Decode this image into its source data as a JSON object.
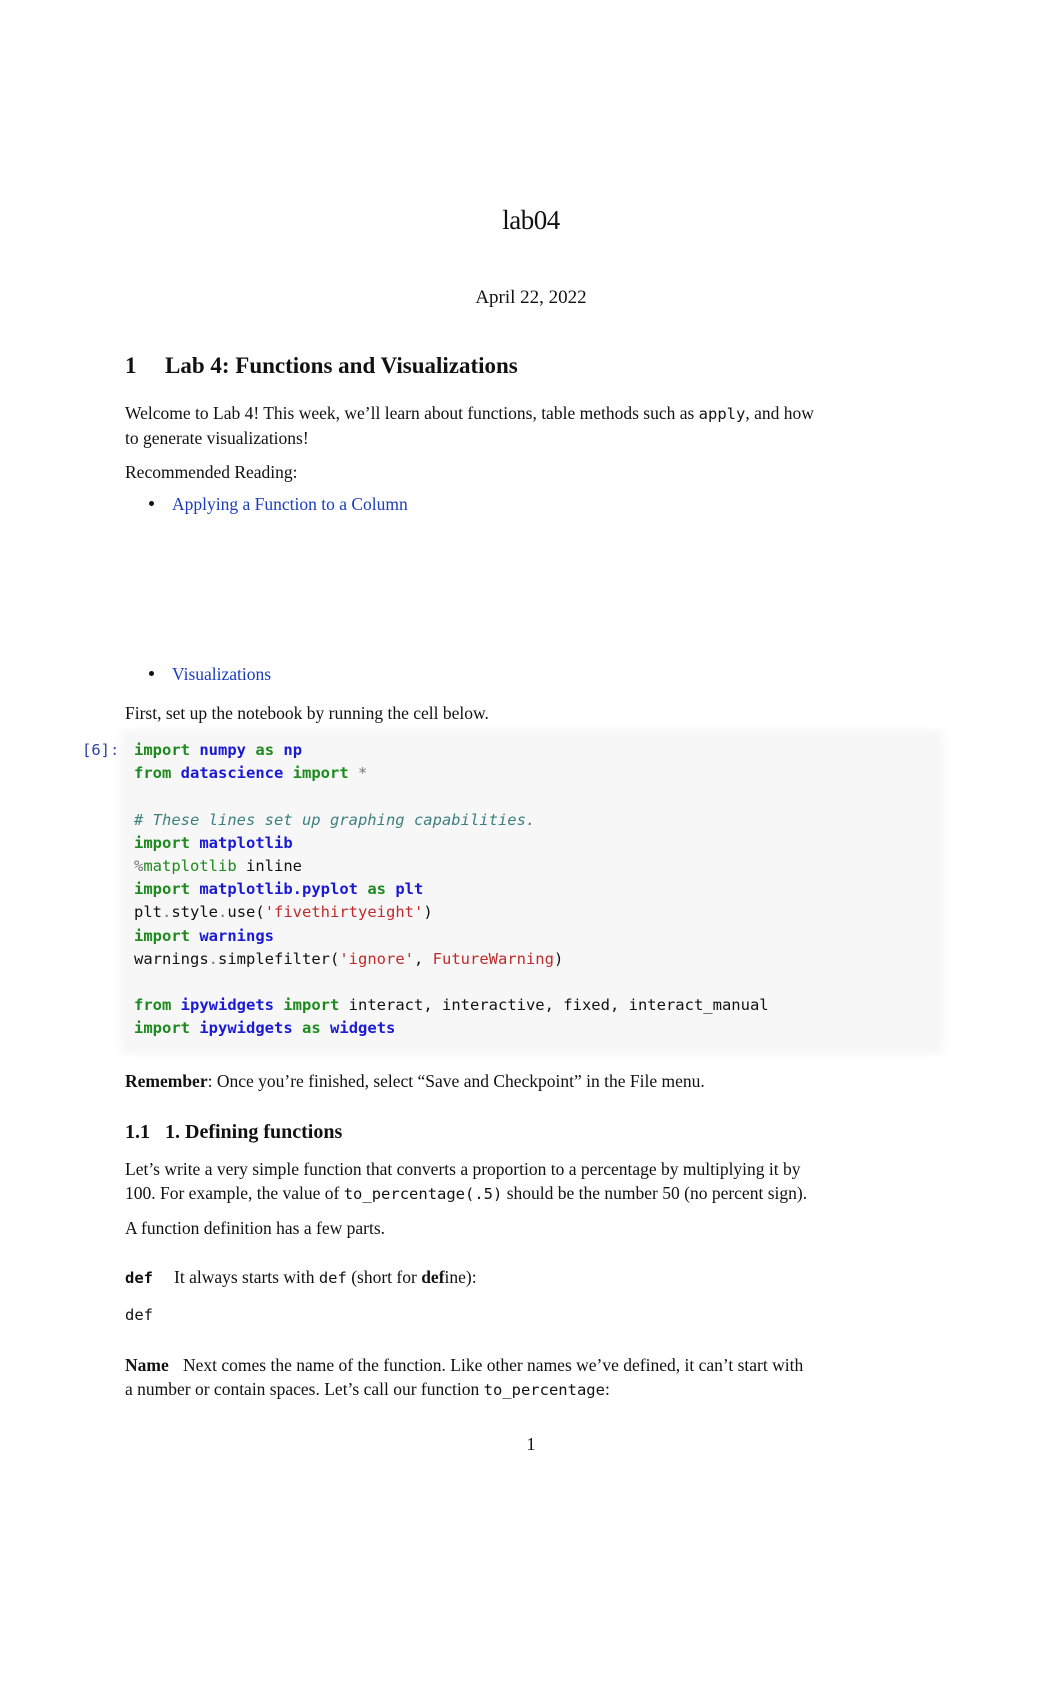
{
  "document": {
    "title": "lab04",
    "date": "April 22, 2022",
    "page_number": "1"
  },
  "section1": {
    "number": "1",
    "title": "Lab 4: Functions and Visualizations",
    "intro_line1_a": "Welcome to Lab 4! This week, we’ll learn about functions, table methods such as ",
    "intro_code": "apply",
    "intro_line1_b": ", and how",
    "intro_line2": "to generate visualizations!",
    "reading_label": "Recommended Reading:",
    "links": [
      {
        "label": "Applying a Function to a Column"
      },
      {
        "label": "Visualizations"
      }
    ],
    "setup_text": "First, set up the notebook by running the cell below."
  },
  "code_cell": {
    "prompt": "[6]:",
    "lines": {
      "l1": {
        "k1": "import",
        "n1": "numpy",
        "k2": "as",
        "n2": "np"
      },
      "l2": {
        "k1": "from",
        "n1": "datascience",
        "k2": "import",
        "o1": "*"
      },
      "l4": {
        "c": "# These lines set up graphing capabilities."
      },
      "l5": {
        "k1": "import",
        "n1": "matplotlib"
      },
      "l6": {
        "o1": "%",
        "m1": "matplotlib",
        "t1": " inline"
      },
      "l7": {
        "k1": "import",
        "n1": "matplotlib.pyplot",
        "k2": "as",
        "n2": "plt"
      },
      "l8": {
        "t1": "plt",
        "o1": ".",
        "t2": "style",
        "o2": ".",
        "t3": "use(",
        "s1": "'fivethirtyeight'",
        "t4": ")"
      },
      "l9": {
        "k1": "import",
        "n1": "warnings"
      },
      "l10": {
        "t1": "warnings",
        "o1": ".",
        "t2": "simplefilter(",
        "s1": "'ignore'",
        "t3": ", ",
        "e1": "FutureWarning",
        "t4": ")"
      },
      "l12": {
        "k1": "from",
        "n1": "ipywidgets",
        "k2": "import",
        "t1": " interact, interactive, fixed, interact_manual"
      },
      "l13": {
        "k1": "import",
        "n1": "ipywidgets",
        "k2": "as",
        "n2": "widgets"
      }
    }
  },
  "remember": {
    "label": "Remember",
    "text": ": Once you’re finished, select “Save and Checkpoint” in the File menu."
  },
  "section1_1": {
    "number": "1.1",
    "title": "1. Defining functions",
    "para1_line1": "Let’s write a very simple function that converts a proportion to a percentage by multiplying it by",
    "para1_line2_a": "100. For example, the value of ",
    "para1_code": "to_percentage(.5)",
    "para1_line2_b": " should be the number 50 (no percent sign).",
    "para2": "A function definition has a few parts.",
    "def_term": "def",
    "def_desc_a": "It always starts with ",
    "def_desc_code": "def",
    "def_desc_b": " (short for ",
    "def_desc_bold": "def",
    "def_desc_c": "ine):",
    "def_code": "def",
    "name_term": "Name",
    "name_desc_line1": "Next comes the name of the function. Like other names we’ve defined, it can’t start with",
    "name_desc_line2_a": "a number or contain spaces. Let’s call our function ",
    "name_desc_code": "to_percentage",
    "name_desc_line2_b": ":"
  }
}
